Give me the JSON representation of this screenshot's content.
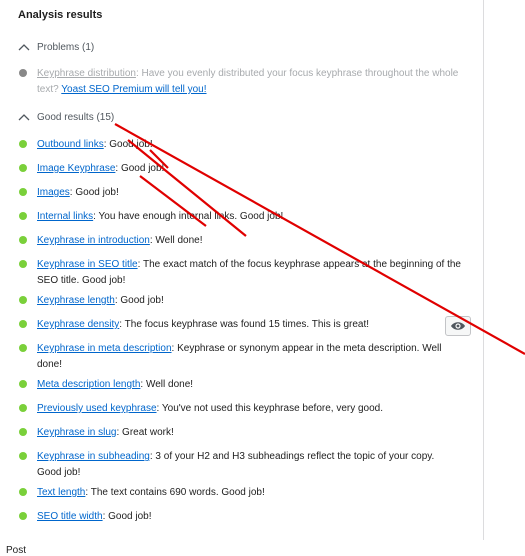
{
  "title": "Analysis results",
  "problems": {
    "heading": "Problems (1)",
    "items": [
      {
        "link": "Keyphrase distribution",
        "text": ": Have you evenly distributed your focus keyphrase throughout the whole text? ",
        "cta": "Yoast SEO Premium will tell you!",
        "status": "gray"
      }
    ]
  },
  "good": {
    "heading": "Good results (15)",
    "items": [
      {
        "link": "Outbound links",
        "text": ": Good job!"
      },
      {
        "link": "Image Keyphrase",
        "text": ": Good job!"
      },
      {
        "link": "Images",
        "text": ": Good job!"
      },
      {
        "link": "Internal links",
        "text": ": You have enough internal links. Good job!"
      },
      {
        "link": "Keyphrase in introduction",
        "text": ": Well done!"
      },
      {
        "link": "Keyphrase in SEO title",
        "text": ": The exact match of the focus keyphrase appears at the beginning of the SEO title. Good job!"
      },
      {
        "link": "Keyphrase length",
        "text": ": Good job!"
      },
      {
        "link": "Keyphrase density",
        "text": ": The focus keyphrase was found 15 times. This is great!"
      },
      {
        "link": "Keyphrase in meta description",
        "text": ": Keyphrase or synonym appear in the meta description. Well done!"
      },
      {
        "link": "Meta description length",
        "text": ": Well done!"
      },
      {
        "link": "Previously used keyphrase",
        "text": ": You've not used this keyphrase before, very good."
      },
      {
        "link": "Keyphrase in slug",
        "text": ": Great work!"
      },
      {
        "link": "Keyphrase in subheading",
        "text": ": 3 of your H2 and H3 subheadings reflect the topic of your copy. Good job!"
      },
      {
        "link": "Text length",
        "text": ": The text contains 690 words. Good job!"
      },
      {
        "link": "SEO title width",
        "text": ": Good job!"
      }
    ]
  },
  "footer": "Post",
  "colors": {
    "good": "#7ad03a",
    "problem": "#888888",
    "link": "#0066cc",
    "annotation": "#e00000"
  },
  "icons": {
    "collapse": "chevron-up-icon",
    "highlight": "eye-icon"
  }
}
